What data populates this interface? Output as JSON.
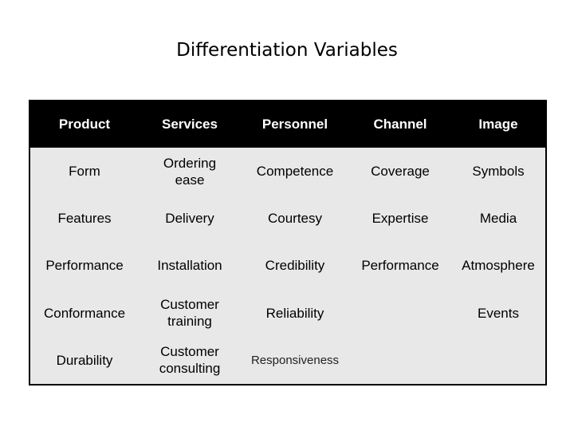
{
  "title": "Differentiation Variables",
  "table": {
    "headers": [
      "Product",
      "Services",
      "Personnel",
      "Channel",
      "Image"
    ],
    "rows": [
      [
        "Form",
        "Ordering ease",
        "Competence",
        "Coverage",
        "Symbols"
      ],
      [
        "Features",
        "Delivery",
        "Courtesy",
        "Expertise",
        "Media"
      ],
      [
        "Performance",
        "Installation",
        "Credibility",
        "Performance",
        "Atmosphere"
      ],
      [
        "Conformance",
        "Customer training",
        "Reliability",
        "",
        "Events"
      ],
      [
        "Durability",
        "Customer consulting",
        "Responsiveness",
        "",
        ""
      ]
    ]
  }
}
